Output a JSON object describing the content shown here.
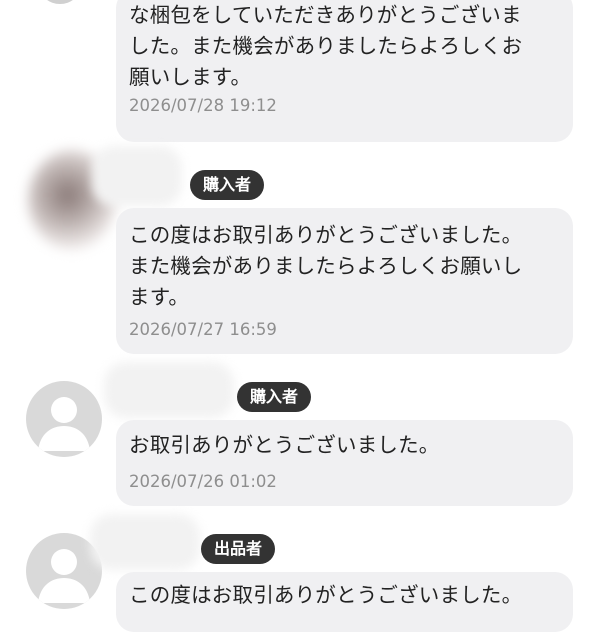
{
  "messages": [
    {
      "text": "な梱包をしていただきありがとうございま\nした。また機会がありましたらよろしくお\n願いします。",
      "timestamp": "2026/07/28 19:12"
    },
    {
      "role": "購入者",
      "text": "この度はお取引ありがとうございました。\nまた機会がありましたらよろしくお願いし\nます。",
      "timestamp": "2026/07/27 16:59"
    },
    {
      "role": "購入者",
      "text": "お取引ありがとうございました。",
      "timestamp": "2026/07/26 01:02"
    },
    {
      "role": "出品者",
      "text": "この度はお取引ありがとうございました。"
    }
  ],
  "colors": {
    "bubble": "#f0f0f2",
    "badge": "#333333",
    "timestamp": "#8e8e8e",
    "avatar_default": "#d9d9d9"
  },
  "icons": [
    "user-silhouette-icon"
  ]
}
